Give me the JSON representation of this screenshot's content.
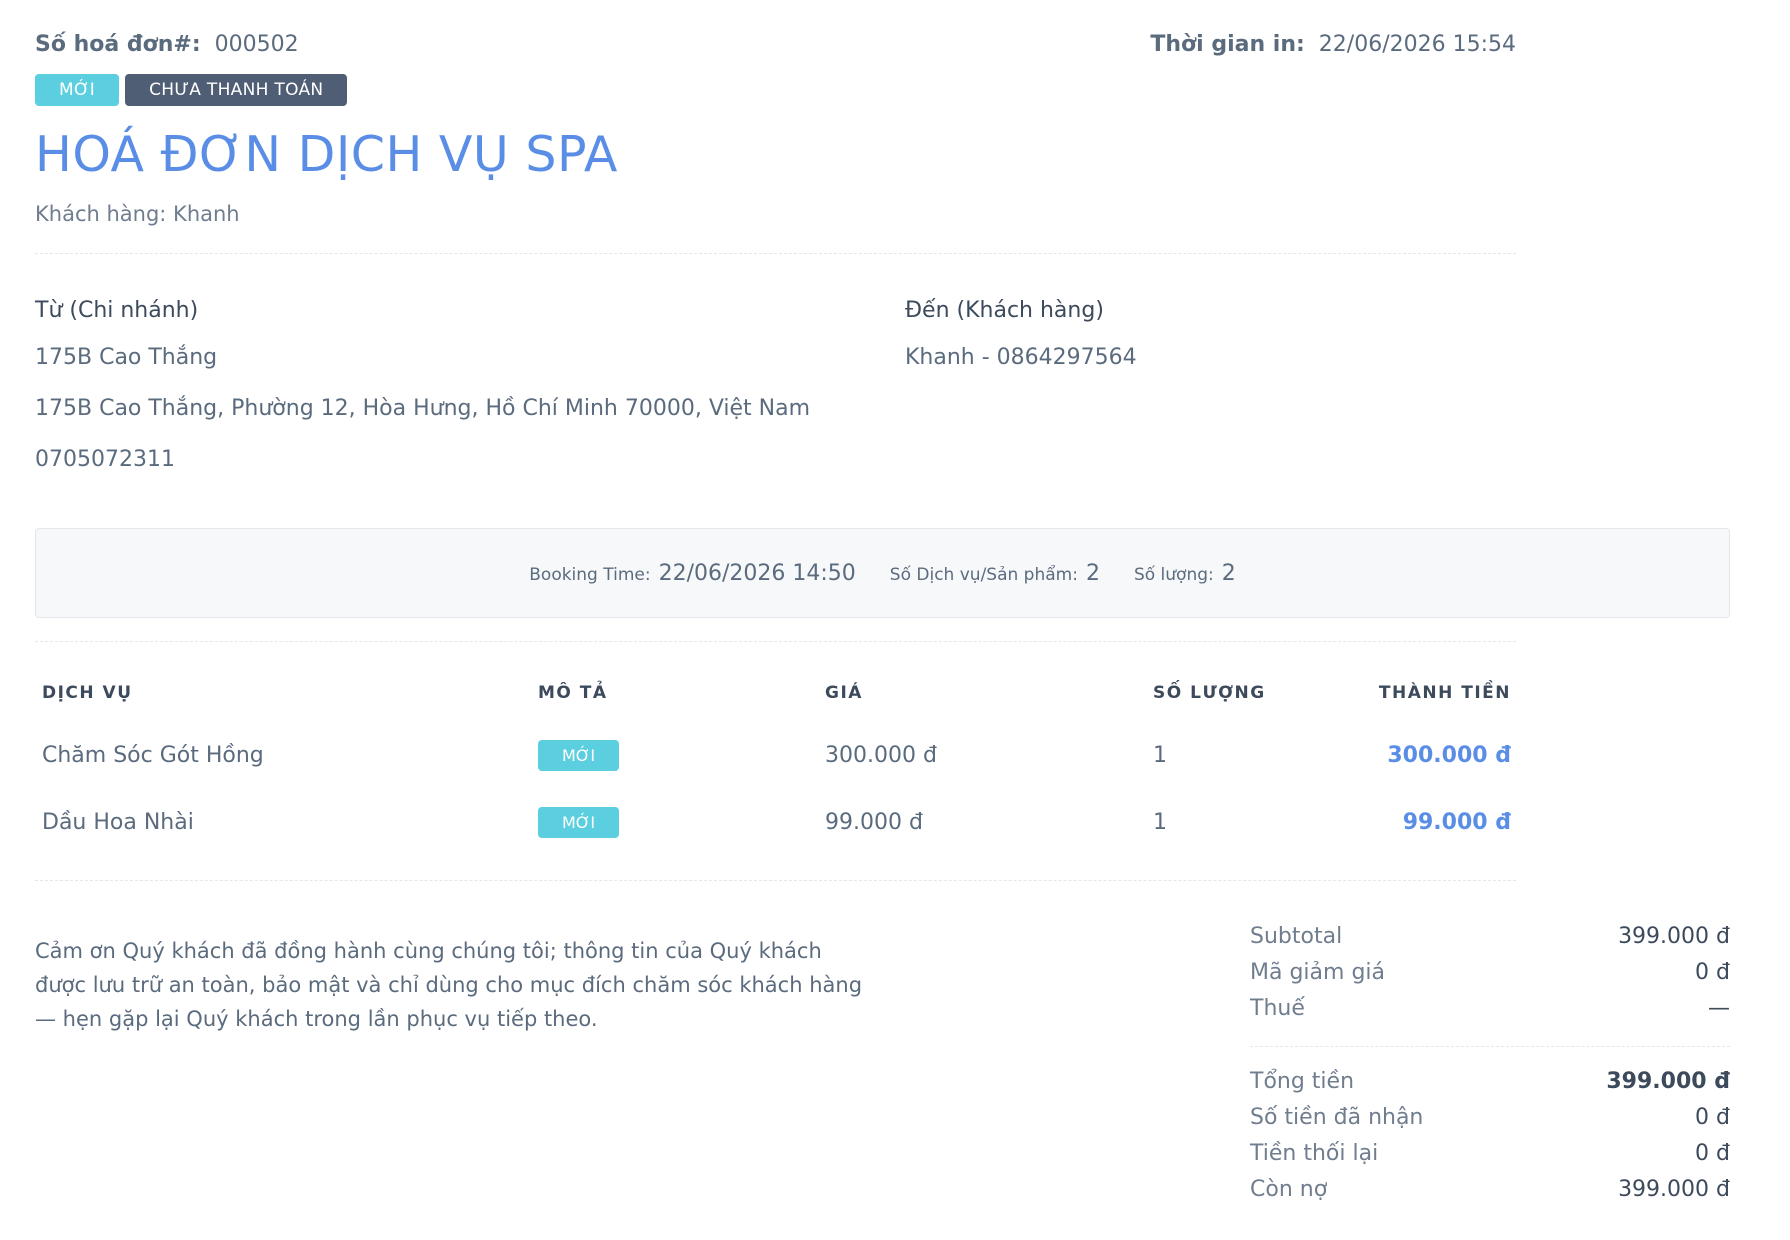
{
  "header": {
    "invoice_no_label": "Số hoá đơn#:",
    "invoice_no": "000502",
    "print_time_label": "Thời gian in:",
    "print_time": "22/06/2026 15:54"
  },
  "badges": {
    "status_new": "MỚI",
    "status_payment": "CHƯA THANH TOÁN"
  },
  "title": "HOÁ ĐƠN DỊCH VỤ SPA",
  "customer_line": "Khách hàng: Khanh",
  "from": {
    "title": "Từ (Chi nhánh)",
    "name": "175B Cao Thắng",
    "address": "175B Cao Thắng, Phường 12, Hòa Hưng, Hồ Chí Minh 70000, Việt Nam",
    "phone": "0705072311"
  },
  "to": {
    "title": "Đến (Khách hàng)",
    "contact": "Khanh - 0864297564"
  },
  "info": {
    "booking_label": "Booking Time:",
    "booking_value": "22/06/2026 14:50",
    "services_label": "Số Dịch vụ/Sản phẩm:",
    "services_value": "2",
    "qty_label": "Số lượng:",
    "qty_value": "2"
  },
  "table": {
    "headers": {
      "service": "DỊCH VỤ",
      "desc": "MÔ TẢ",
      "price": "GIÁ",
      "qty": "SỐ LƯỢNG",
      "total": "THÀNH TIỀN"
    },
    "rows": [
      {
        "service": "Chăm Sóc Gót Hồng",
        "badge": "MỚI",
        "price": "300.000 đ",
        "qty": "1",
        "total": "300.000 đ"
      },
      {
        "service": "Dầu Hoa Nhài",
        "badge": "MỚI",
        "price": "99.000 đ",
        "qty": "1",
        "total": "99.000 đ"
      }
    ]
  },
  "thanks": "Cảm ơn Quý khách đã đồng hành cùng chúng tôi; thông tin của Quý khách được lưu trữ an toàn, bảo mật và chỉ dùng cho mục đích chăm sóc khách hàng — hẹn gặp lại Quý khách trong lần phục vụ tiếp theo.",
  "totals": {
    "subtotal_label": "Subtotal",
    "subtotal": "399.000 đ",
    "discount_label": "Mã giảm giá",
    "discount": "0 đ",
    "tax_label": "Thuế",
    "tax": "—",
    "total_label": "Tổng tiền",
    "total": "399.000 đ",
    "received_label": "Số tiền đã nhận",
    "received": "0 đ",
    "change_label": "Tiền thối lại",
    "change": "0 đ",
    "debt_label": "Còn nợ",
    "debt": "399.000 đ"
  }
}
